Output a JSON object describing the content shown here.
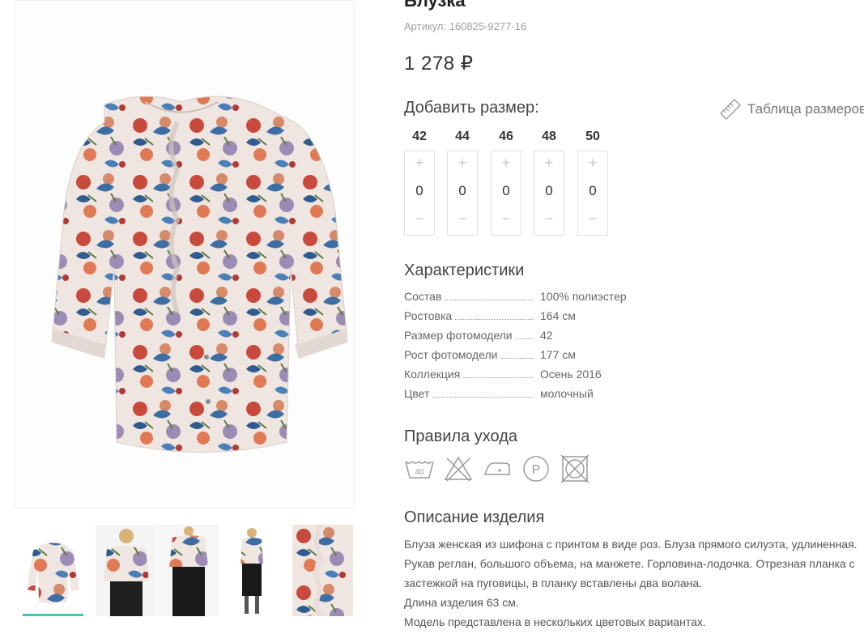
{
  "product": {
    "title": "Блузка",
    "sku": "Артикул: 160825-9277-16",
    "price": "1 278 ₽"
  },
  "sizes": {
    "heading": "Добавить размер:",
    "size_table_link": "Таблица размеров",
    "items": [
      {
        "size": "42",
        "qty": "0",
        "plus": "+",
        "minus": "−"
      },
      {
        "size": "44",
        "qty": "0",
        "plus": "+",
        "minus": "−"
      },
      {
        "size": "46",
        "qty": "0",
        "plus": "+",
        "minus": "−"
      },
      {
        "size": "48",
        "qty": "0",
        "plus": "+",
        "minus": "−"
      },
      {
        "size": "50",
        "qty": "0",
        "plus": "+",
        "minus": "−"
      }
    ]
  },
  "characteristics": {
    "heading": "Характеристики",
    "rows": [
      {
        "name": "Состав",
        "value": "100% полиэстер"
      },
      {
        "name": "Ростовка",
        "value": "164 см"
      },
      {
        "name": "Размер фотомодели",
        "value": "42"
      },
      {
        "name": "Рост фотомодели",
        "value": "177 см"
      },
      {
        "name": "Коллекция",
        "value": "Осень 2016"
      },
      {
        "name": "Цвет",
        "value": "молочный"
      }
    ]
  },
  "care": {
    "heading": "Правила ухода",
    "icons": [
      "wash-40-icon",
      "no-bleach-icon",
      "iron-low-icon",
      "dry-clean-p-icon",
      "no-tumble-dry-icon"
    ],
    "wash_temp": "40",
    "dry_clean_letter": "P"
  },
  "description": {
    "heading": "Описание изделия",
    "lines": [
      "Блуза женская из шифона с принтом в виде роз. Блуза прямого силуэта, удлиненная.",
      "Рукав реглан, большого объема, на манжете. Горловина-лодочка. Отрезная планка с",
      "застежкой на пуговицы, в планку вставлены два волана.",
      "Длина изделия 63 см.",
      "Модель представлена в нескольких цветовых вариантах."
    ]
  },
  "gallery": {
    "active_index": 0,
    "accent_color": "#3ccbb0"
  }
}
